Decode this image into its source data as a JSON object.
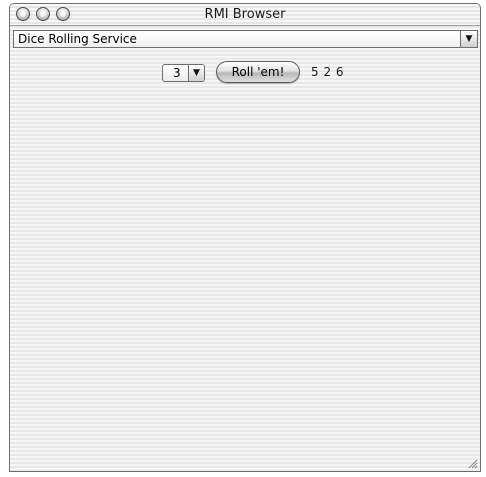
{
  "window": {
    "title": "RMI Browser"
  },
  "service": {
    "selected": "Dice Rolling Service"
  },
  "dice": {
    "count": "3",
    "roll_label": "Roll 'em!",
    "result": "5 2 6"
  }
}
